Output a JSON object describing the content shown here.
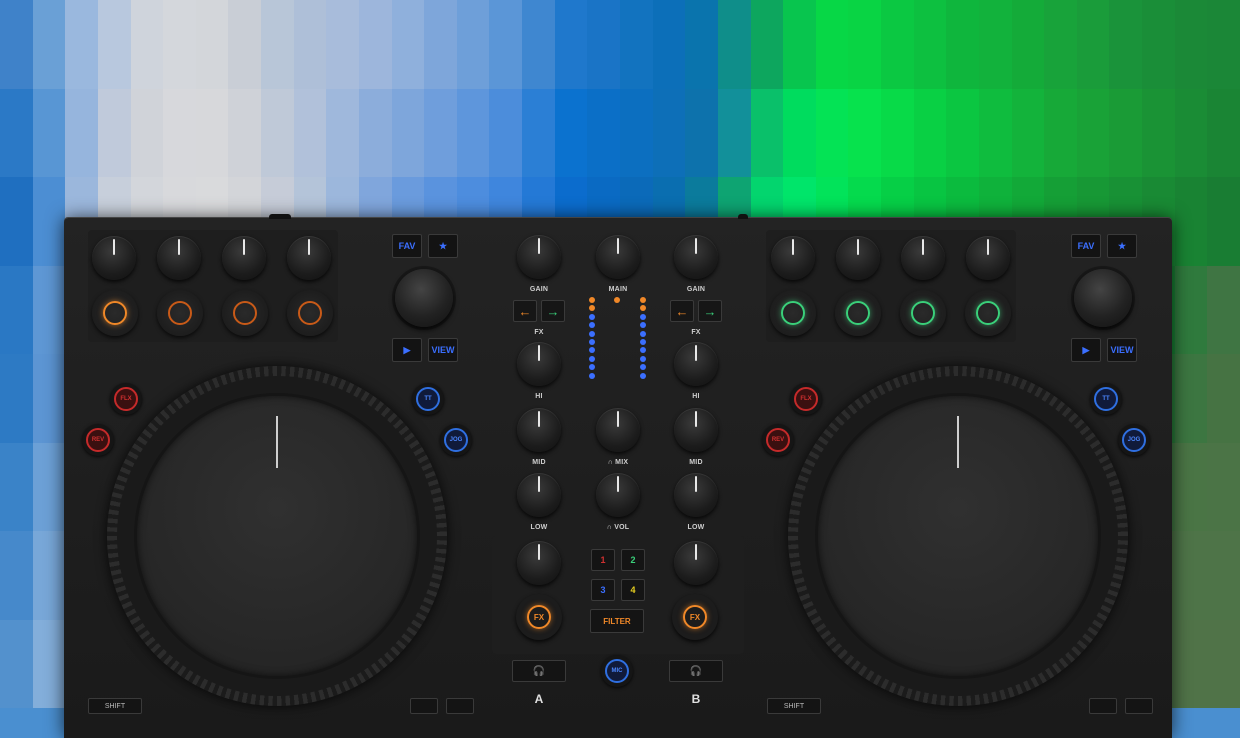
{
  "colors": {
    "accent_orange": "#f08828",
    "accent_green": "#3ad07a",
    "accent_blue": "#3b6fff",
    "accent_red": "#c52a2a",
    "body": "#1c1c1c"
  },
  "mosaic": [
    [
      "#3f82c9",
      "#6aa0d6",
      "#9ab8de",
      "#b8c8de",
      "#cfd4dc",
      "#d4d7dc",
      "#d3d6da",
      "#c9ced6",
      "#b8c6d8",
      "#aebfd8",
      "#a8bcdb",
      "#9db6dc",
      "#8fb0dc",
      "#7ea6da",
      "#6e9fd9",
      "#5b96d7",
      "#3f87d0",
      "#1f78cc",
      "#1a74c6",
      "#1273bf",
      "#0c6fb9",
      "#0a74ad",
      "#0f8e8a",
      "#0da65e",
      "#08c54e",
      "#07d746",
      "#09d444",
      "#0bc842",
      "#0dc040",
      "#0fb63d",
      "#12b23c",
      "#14ab39",
      "#18a33a",
      "#1a9c3a",
      "#1a933a",
      "#1a8e38",
      "#1b8937",
      "#1b8737"
    ],
    [
      "#2b79c6",
      "#5896d4",
      "#96b5dd",
      "#c0cadb",
      "#d0d3d9",
      "#d7d8dc",
      "#d7d8db",
      "#cfd2d8",
      "#bfc9d8",
      "#b1c1da",
      "#9fb8dc",
      "#8caddb",
      "#7ea6db",
      "#6f9edc",
      "#5e96dc",
      "#4c8ddb",
      "#2b7fd5",
      "#0b72cf",
      "#0b6fc7",
      "#0c6fc0",
      "#0d6fb8",
      "#0d72ac",
      "#12909a",
      "#0ac06a",
      "#00dc5e",
      "#04e355",
      "#07e24d",
      "#08da48",
      "#09d044",
      "#0bc641",
      "#0fbc3e",
      "#13b33b",
      "#17a938",
      "#19a237",
      "#1a9b36",
      "#1a9335",
      "#1a8c35",
      "#1a8534"
    ],
    [
      "#1f6fc0",
      "#4c8ed3",
      "#9bb7dc",
      "#c7cfdb",
      "#d3d6db",
      "#d8d9dc",
      "#d9dadc",
      "#d3d5d9",
      "#c6ccd8",
      "#b4c4d9",
      "#9cb7dc",
      "#80a6dc",
      "#6a9bdd",
      "#5a93de",
      "#4d8dde",
      "#3f86dd",
      "#2479d6",
      "#0b6ccd",
      "#0a6ac3",
      "#0b6ab9",
      "#0a6eb0",
      "#0b7b9c",
      "#0ea472",
      "#03d56e",
      "#00e56a",
      "#02e35a",
      "#05da4d",
      "#06cf46",
      "#08c542",
      "#0bbb3e",
      "#0fb23b",
      "#12a938",
      "#159f36",
      "#179835",
      "#189135",
      "#198a34",
      "#198333",
      "#197d33"
    ],
    [
      "#2a78c4",
      "#5e97d4",
      "#a3bbdb",
      "#c8cfdb",
      "#d3d6db",
      "#d8d9dc",
      "#d9dadc",
      "#d4d6da",
      "#c9cfd9",
      "#b8c6d9",
      "#9fb8dc",
      "#83a8dc",
      "#6c9cdd",
      "#5a93de",
      "#4b8cde",
      "#3c85dd",
      "#2277d5",
      "#0a6bcb",
      "#096ac1",
      "#0a6ab6",
      "#0a6faa",
      "#0c7f92",
      "#0fa968",
      "#05d663",
      "#03d85a",
      "#05d250",
      "#07c849",
      "#09be44",
      "#0cb541",
      "#0fac3e",
      "#12a43b",
      "#159b39",
      "#179437",
      "#188d36",
      "#198735",
      "#198134",
      "#2f7a3d",
      "#3f7543"
    ],
    [
      "#2d7ac4",
      "#5c95d3",
      "#9bb6db",
      "#c3ccdb",
      "#d0d4db",
      "#d6d8dc",
      "#d7d8db",
      "#d1d4d9",
      "#c3cad8",
      "#b0c1d9",
      "#96b2db",
      "#7aa3dc",
      "#6599dd",
      "#548fde",
      "#4688de",
      "#3882dc",
      "#1f74d3",
      "#0a69c8",
      "#0968bd",
      "#0a69b1",
      "#0b6ca5",
      "#0d7a8e",
      "#0f9e67",
      "#07c65a",
      "#05cb55",
      "#07c74e",
      "#09bf48",
      "#0bb644",
      "#0dae40",
      "#10a63e",
      "#139e3b",
      "#159739",
      "#179038",
      "#188a36",
      "#198435",
      "#2a7d3a",
      "#3c7641",
      "#467343"
    ],
    [
      "#3a83c8",
      "#6ca0d6",
      "#a6bddc",
      "#c6cedb",
      "#d1d4db",
      "#d6d8dc",
      "#d6d7db",
      "#cfd2d8",
      "#bfc7d7",
      "#aabcd8",
      "#8faedb",
      "#74a0dc",
      "#6096dd",
      "#508dde",
      "#4287dd",
      "#3480db",
      "#1d73d1",
      "#0a68c6",
      "#0967ba",
      "#0a68ae",
      "#0b6ba2",
      "#0d778c",
      "#0f9766",
      "#08bb56",
      "#06c053",
      "#08bd4c",
      "#0ab647",
      "#0cae43",
      "#0ea740",
      "#11a03d",
      "#13993b",
      "#159339",
      "#168d38",
      "#258538",
      "#367e3d",
      "#437843",
      "#4a7545",
      "#4b7446"
    ],
    [
      "#4689cb",
      "#78a7d8",
      "#adc1dc",
      "#c8cfdb",
      "#d1d4db",
      "#d5d7db",
      "#d4d6da",
      "#ccd0d7",
      "#bbc4d6",
      "#a5b8d7",
      "#8aaada",
      "#709ddb",
      "#5d94dc",
      "#4e8bdd",
      "#4085dc",
      "#327eda",
      "#1c71cf",
      "#0b67c3",
      "#0a66b7",
      "#0b67ab",
      "#0c6a9f",
      "#0e7489",
      "#0f8f66",
      "#0aae55",
      "#08b252",
      "#0ab14c",
      "#0cac47",
      "#0ea543",
      "#109f40",
      "#12993e",
      "#14933c",
      "#1a8c3a",
      "#2a843b",
      "#3a7d40",
      "#467845",
      "#4d7547",
      "#4e7448",
      "#4e7448"
    ],
    [
      "#5391cd",
      "#83aeda",
      "#b2c4dc",
      "#c9d0db",
      "#d0d4db",
      "#d3d6db",
      "#d2d4da",
      "#c9ced6",
      "#b7c1d5",
      "#a0b5d6",
      "#86a8d9",
      "#6d9cdb",
      "#5b93dc",
      "#4d8adc",
      "#3f84db",
      "#317dd9",
      "#1b70cd",
      "#0b66c0",
      "#0a65b4",
      "#0b66a8",
      "#0c699c",
      "#0e7286",
      "#0f8a65",
      "#0ca355",
      "#0aa652",
      "#0ca64d",
      "#0ea248",
      "#109d44",
      "#129841",
      "#14933f",
      "#1a8d3d",
      "#26873c",
      "#34813e",
      "#417b42",
      "#4a7746",
      "#4f7448",
      "#507348",
      "#507348"
    ]
  ],
  "left_deck": {
    "fav_label": "FAV",
    "star_label": "★",
    "play_label": "▶",
    "view_label": "VIEW",
    "flx_label": "FLX",
    "rev_label": "REV",
    "tt_label": "TT",
    "jog_label": "JOG",
    "letter": "A",
    "bottom_left_label": "SHIFT"
  },
  "right_deck": {
    "fav_label": "FAV",
    "star_label": "★",
    "play_label": "▶",
    "view_label": "VIEW",
    "flx_label": "FLX",
    "rev_label": "REV",
    "tt_label": "TT",
    "jog_label": "JOG",
    "letter": "B",
    "bottom_left_label": "SHIFT"
  },
  "mixer": {
    "gain_a": "GAIN",
    "main": "MAIN",
    "gain_b": "GAIN",
    "fx_a": "FX",
    "fx_b": "FX",
    "hi_a": "HI",
    "hi_b": "HI",
    "mid_a": "MID",
    "mix": "∩ MIX",
    "mid_b": "MID",
    "low_a": "LOW",
    "vol": "∩ VOL",
    "low_b": "LOW",
    "fx_button": "FX",
    "filter": "FILTER",
    "mic": "MIC",
    "headphone": "🎧",
    "arrow_left": "←",
    "arrow_right": "→",
    "pads": [
      "1",
      "2",
      "3",
      "4"
    ],
    "pad_colors": [
      "#d03030",
      "#3ad07a",
      "#3b6fff",
      "#e8d020"
    ]
  }
}
